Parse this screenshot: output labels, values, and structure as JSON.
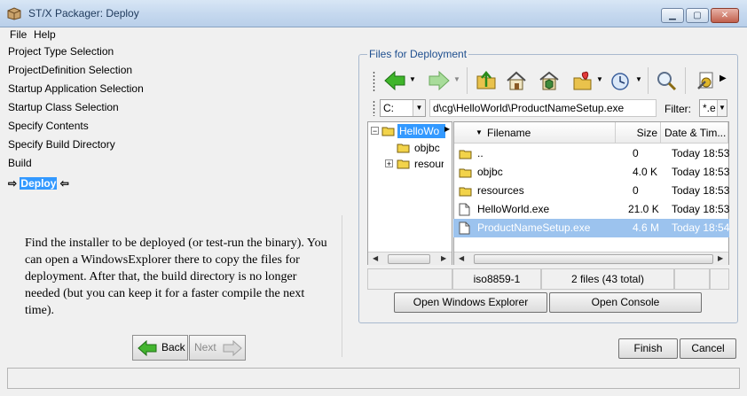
{
  "window": {
    "title": "ST/X Packager: Deploy",
    "controls": [
      "minimize",
      "maximize",
      "close"
    ]
  },
  "menu": [
    "File",
    "Help"
  ],
  "steps": [
    {
      "label": "Project Type Selection"
    },
    {
      "label": "ProjectDefinition Selection"
    },
    {
      "label": "Startup Application Selection"
    },
    {
      "label": "Startup Class Selection"
    },
    {
      "label": "Specify Contents"
    },
    {
      "label": "Specify Build Directory"
    },
    {
      "label": "Build"
    }
  ],
  "current_step": "Deploy",
  "description": "Find the installer to be deployed (or test-run the binary). You can open a WindowsExplorer there to copy the files for deployment. After that, the build directory is no longer needed (but you can keep it for a faster compile the next time).",
  "nav": {
    "back": "Back",
    "next": "Next",
    "finish": "Finish",
    "cancel": "Cancel"
  },
  "deployment": {
    "title": "Files for Deployment",
    "drive": "C:",
    "path": "d\\cg\\HelloWorld\\ProductNameSetup.exe",
    "filter_label": "Filter:",
    "filter": "*.e",
    "tree": [
      {
        "label": "HelloWo",
        "expanded": true,
        "selected": true
      },
      {
        "label": "objbc"
      },
      {
        "label": "resour",
        "expandable": true
      }
    ],
    "columns": {
      "filename": "Filename",
      "size": "Size",
      "date": "Date & Tim..."
    },
    "files": [
      {
        "name": "..",
        "size": "0",
        "date": "Today 18:53",
        "type": "folder"
      },
      {
        "name": "objbc",
        "size": "4.0 K",
        "date": "Today 18:53",
        "type": "folder"
      },
      {
        "name": "resources",
        "size": "0",
        "date": "Today 18:53",
        "type": "folder"
      },
      {
        "name": "HelloWorld.exe",
        "size": "21.0 K",
        "date": "Today 18:53",
        "type": "file"
      },
      {
        "name": "ProductNameSetup.exe",
        "size": "4.6 M",
        "date": "Today 18:54",
        "type": "file",
        "selected": true
      }
    ],
    "status": {
      "encoding": "iso8859-1",
      "summary": "2 files (43 total)"
    },
    "buttons": {
      "open_explorer": "Open Windows Explorer",
      "open_console": "Open Console"
    }
  },
  "colors": {
    "selection": "#3399ff",
    "row_selected": "#9cc3ee",
    "group_title": "#1f4f8f"
  }
}
